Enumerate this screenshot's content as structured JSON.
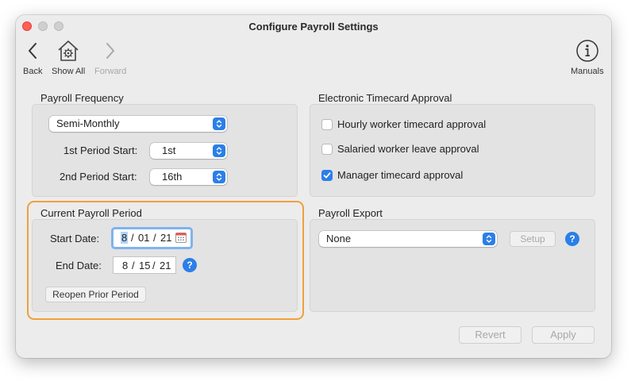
{
  "window": {
    "title": "Configure Payroll Settings"
  },
  "toolbar": {
    "back_label": "Back",
    "show_all_label": "Show All",
    "forward_label": "Forward",
    "manuals_label": "Manuals"
  },
  "payroll_frequency": {
    "title": "Payroll Frequency",
    "frequency_value": "Semi-Monthly",
    "first_period_label": "1st Period Start:",
    "first_period_value": "1st",
    "second_period_label": "2nd Period Start:",
    "second_period_value": "16th"
  },
  "timecard_approval": {
    "title": "Electronic Timecard Approval",
    "options": [
      {
        "label": "Hourly worker timecard approval",
        "checked": false
      },
      {
        "label": "Salaried worker leave approval",
        "checked": false
      },
      {
        "label": "Manager timecard approval",
        "checked": true
      }
    ]
  },
  "current_period": {
    "title": "Current Payroll Period",
    "start_label": "Start Date:",
    "start_month": "8",
    "start_day": "01",
    "start_year": "21",
    "end_label": "End Date:",
    "end_month": "8",
    "end_day": "15",
    "end_year": "21",
    "date_separator": "/",
    "reopen_label": "Reopen Prior Period"
  },
  "payroll_export": {
    "title": "Payroll Export",
    "export_value": "None",
    "setup_label": "Setup"
  },
  "footer": {
    "revert_label": "Revert",
    "apply_label": "Apply"
  },
  "help_glyph": "?",
  "colors": {
    "accent": "#2b7fe8",
    "highlight": "#f0a03c",
    "close": "#fe5f57"
  }
}
